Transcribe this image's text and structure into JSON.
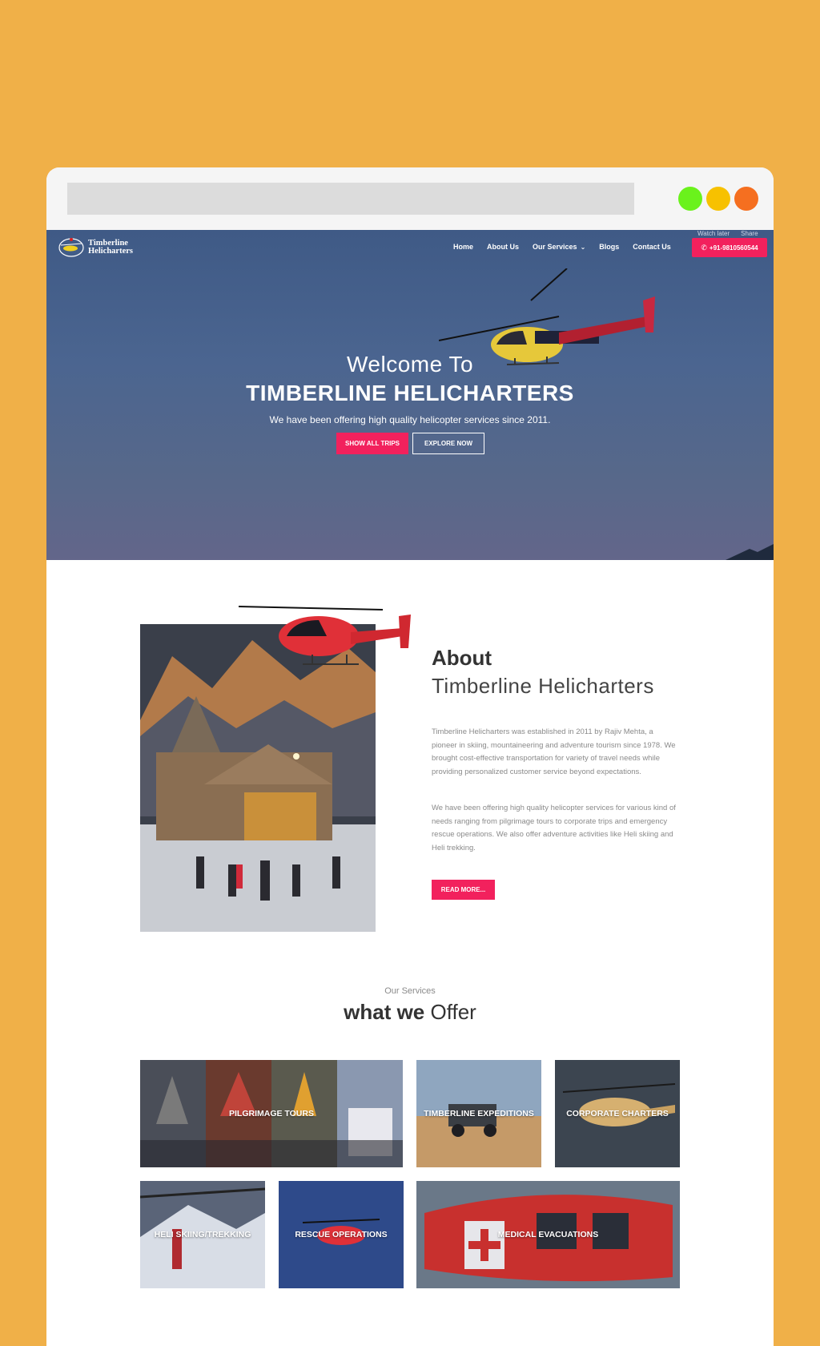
{
  "site": {
    "logo_line1": "Timberline",
    "logo_line2": "Helicharters"
  },
  "youtube": {
    "watch_later": "Watch later",
    "share": "Share"
  },
  "nav": {
    "home": "Home",
    "about": "About Us",
    "services": "Our Services",
    "blogs": "Blogs",
    "contact": "Contact Us",
    "phone": "+91-9810560544"
  },
  "hero": {
    "welcome": "Welcome To",
    "brand": "TIMBERLINE HELICHARTERS",
    "tagline": "We have been offering high quality helicopter services since 2011.",
    "btn_show": "SHOW ALL TRIPS",
    "btn_explore": "EXPLORE NOW"
  },
  "about": {
    "heading": "About",
    "subheading": "Timberline Helicharters",
    "para1": "Timberline Helicharters was established in 2011 by Rajiv Mehta, a pioneer in skiing, mountaineering and adventure tourism since 1978. We brought cost-effective transportation for variety of travel needs while providing personalized customer service beyond expectations.",
    "para2": "We have been offering high quality helicopter services for various kind of needs ranging from pilgrimage tours to corporate trips and emergency rescue operations. We also offer adventure activities like Heli skiing and Heli trekking.",
    "read_more": "READ MORE..."
  },
  "services": {
    "overline": "Our Services",
    "title_bold": "what we",
    "title_light": "Offer",
    "tiles": [
      {
        "label": "PILGRIMAGE TOURS"
      },
      {
        "label": "TIMBERLINE EXPEDITIONS"
      },
      {
        "label": "CORPORATE CHARTERS"
      },
      {
        "label": "HELI SKIING/TREKKING"
      },
      {
        "label": "RESCUE OPERATIONS"
      },
      {
        "label": "MEDICAL EVACUATIONS"
      }
    ]
  },
  "colors": {
    "page_bg": "#F0B048",
    "accent": "#F2215D",
    "hero_sky": "#4b6590"
  }
}
